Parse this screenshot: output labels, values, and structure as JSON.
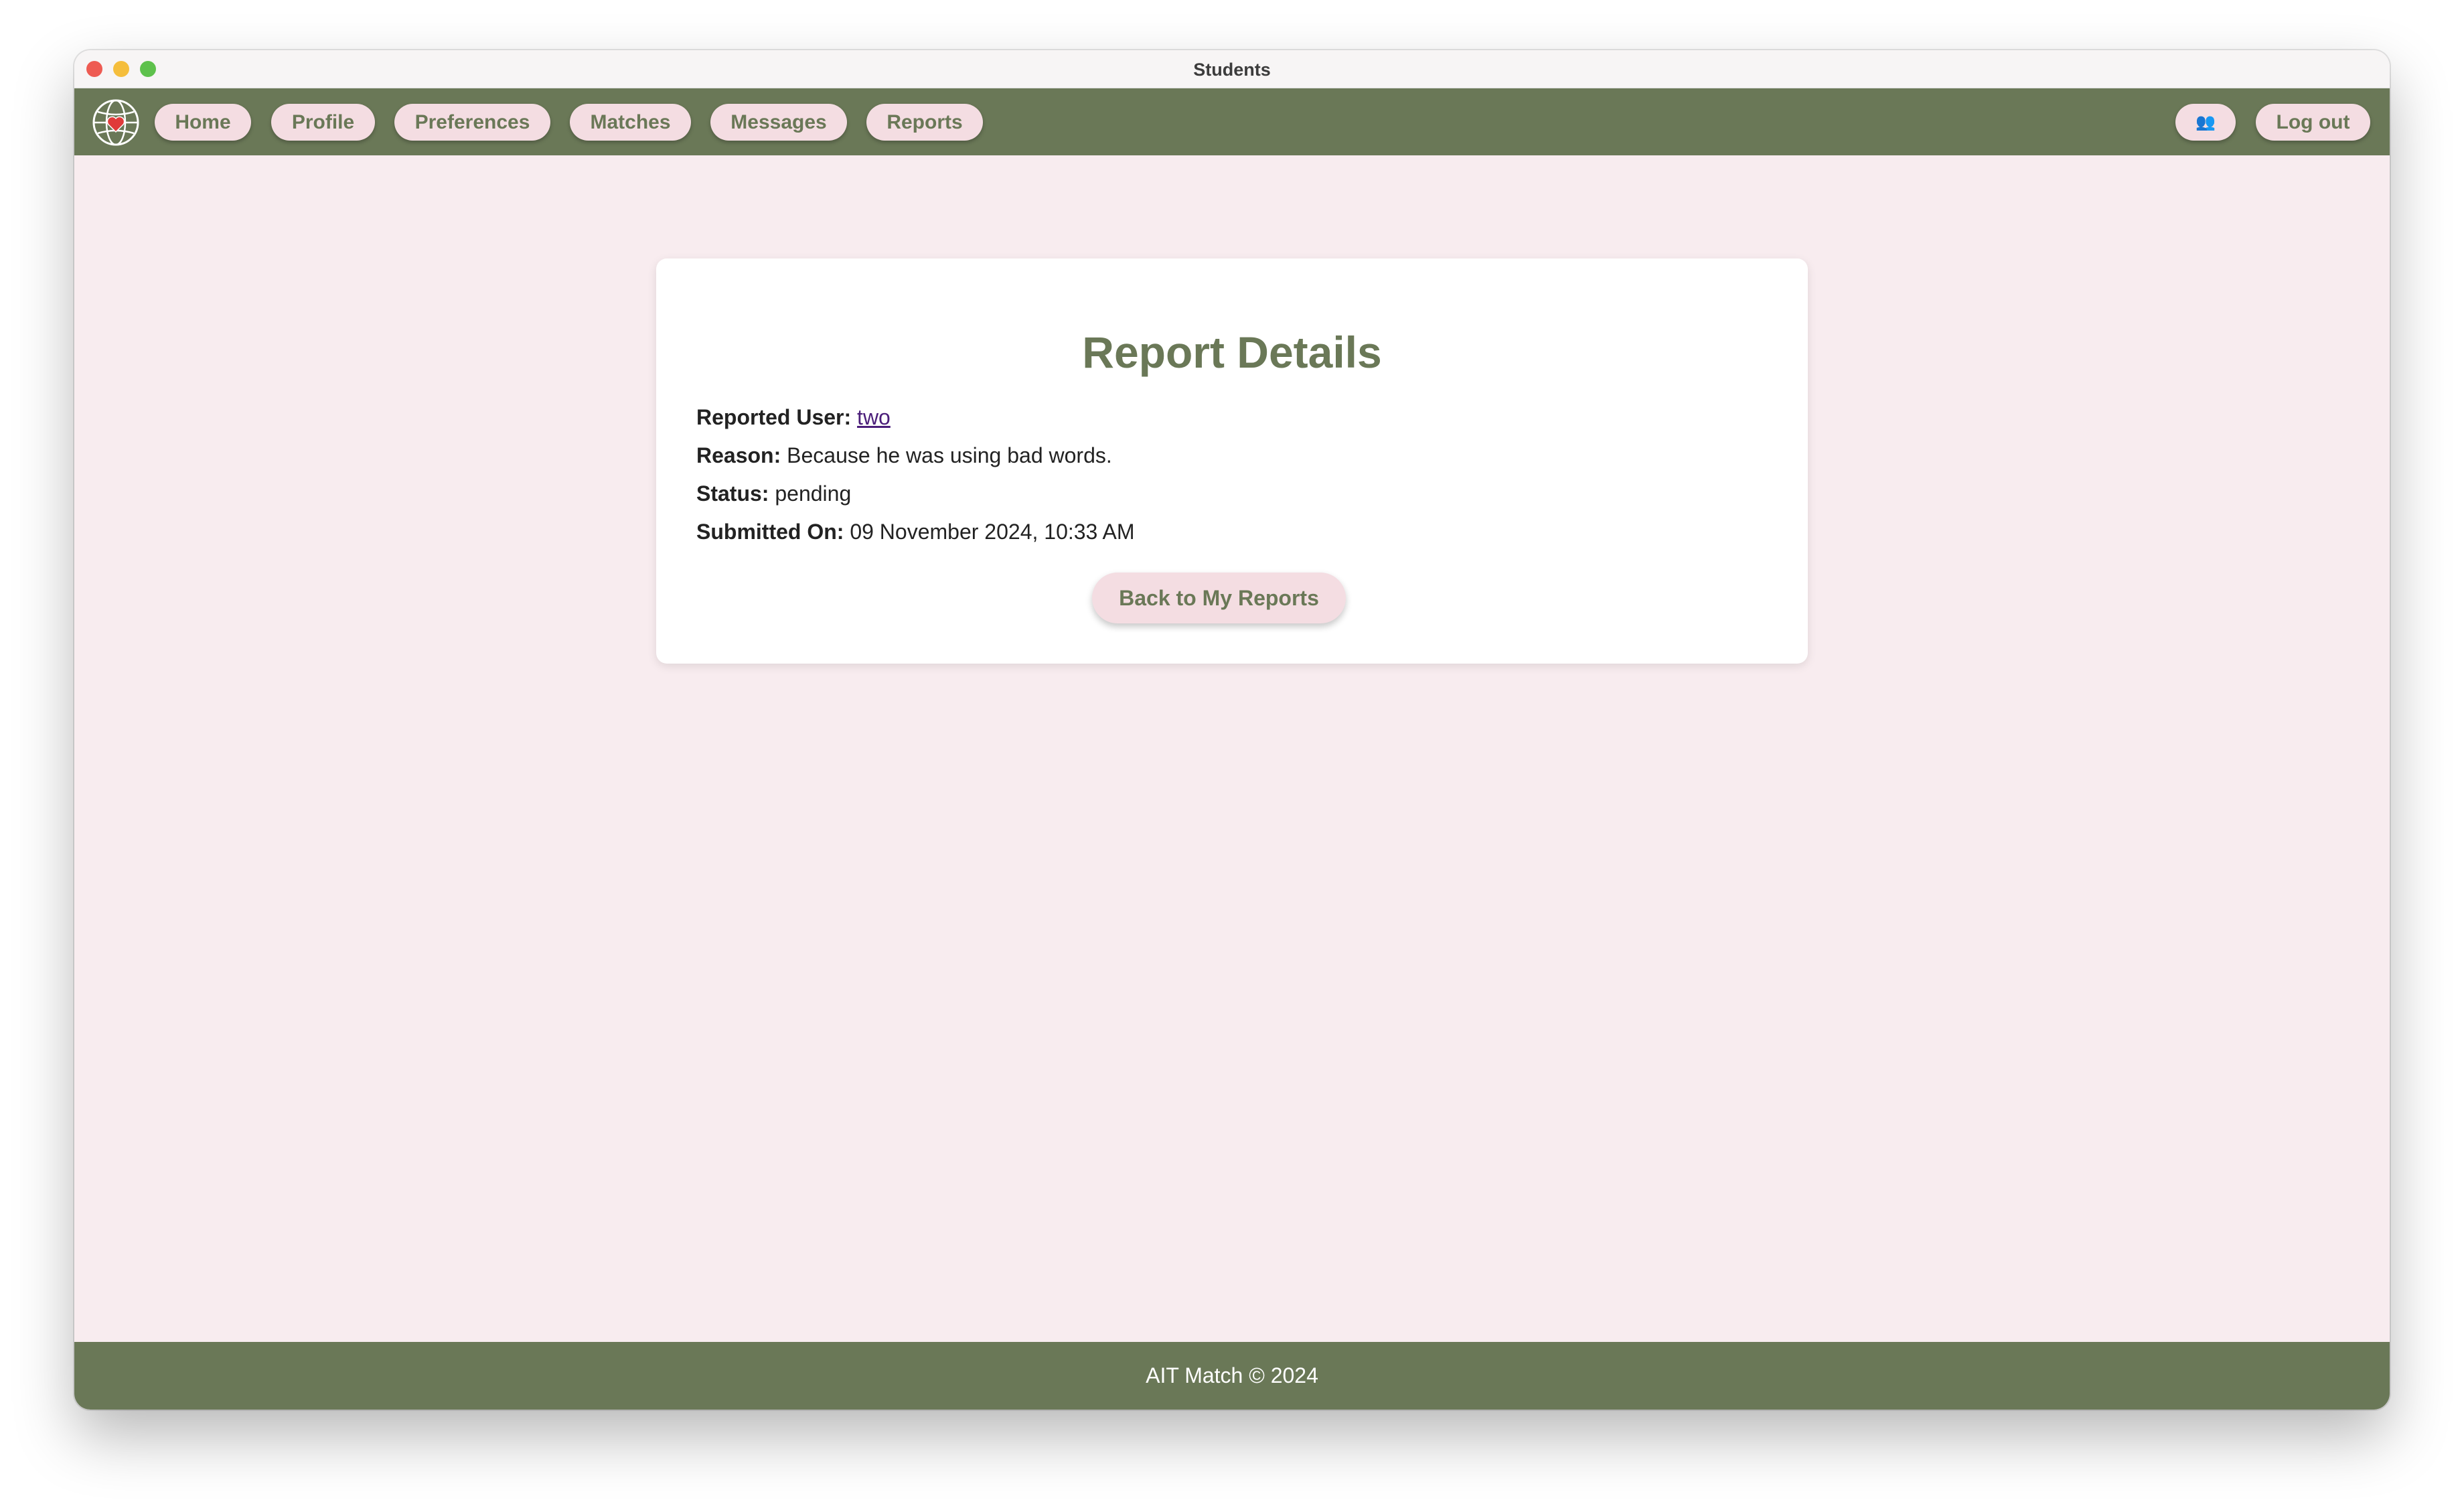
{
  "window": {
    "title": "Students"
  },
  "nav": {
    "items": [
      {
        "label": "Home"
      },
      {
        "label": "Profile"
      },
      {
        "label": "Preferences"
      },
      {
        "label": "Matches"
      },
      {
        "label": "Messages"
      },
      {
        "label": "Reports"
      }
    ],
    "users_icon": "👥",
    "logout_label": "Log out"
  },
  "report": {
    "title": "Report Details",
    "reported_user_label": "Reported User:",
    "reported_user_value": "two",
    "reason_label": "Reason:",
    "reason_value": "Because he was using bad words.",
    "status_label": "Status:",
    "status_value": "pending",
    "submitted_label": "Submitted On:",
    "submitted_value": "09 November 2024, 10:33 AM",
    "back_button": "Back to My Reports"
  },
  "footer": {
    "text": "AIT Match © 2024"
  },
  "colors": {
    "primary": "#6a7857",
    "button_bg": "#f4dde2",
    "page_bg": "#f8ecef",
    "link": "#4b1e7a"
  }
}
